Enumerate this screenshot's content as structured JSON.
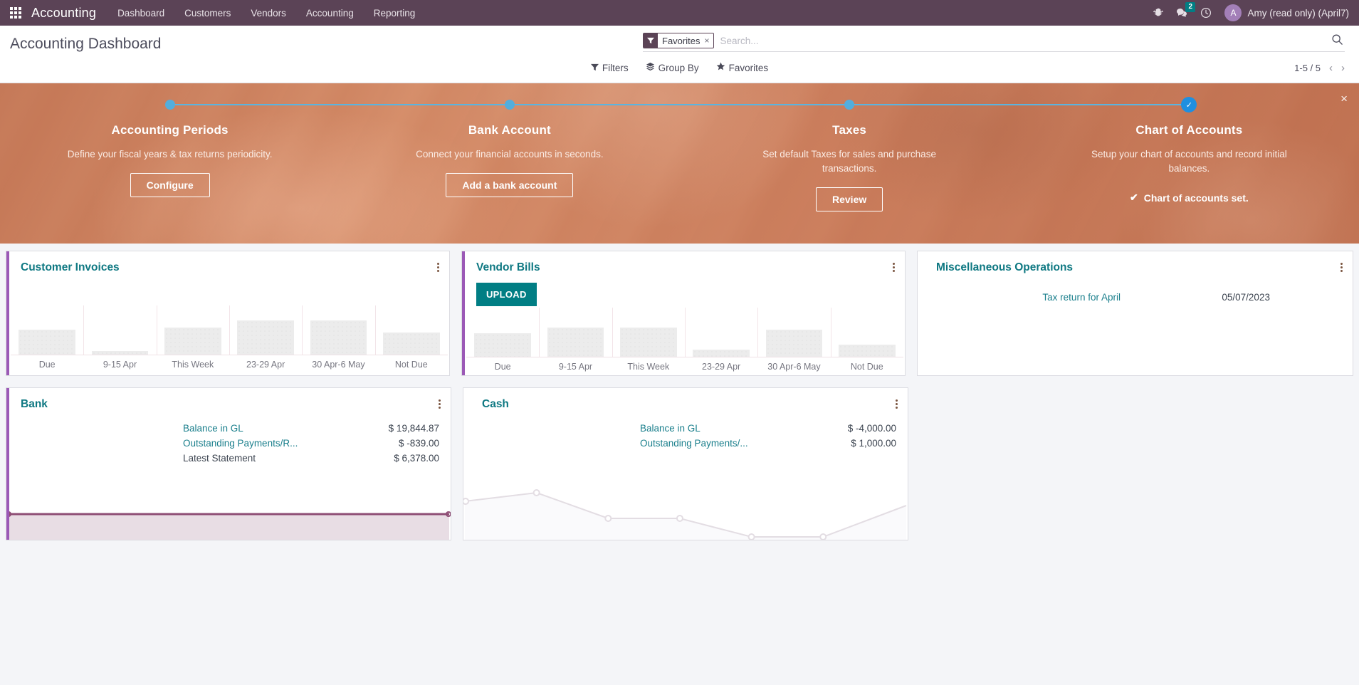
{
  "navbar": {
    "apps_icon": "apps-grid-icon",
    "brand": "Accounting",
    "menus": [
      "Dashboard",
      "Customers",
      "Vendors",
      "Accounting",
      "Reporting"
    ],
    "bug_icon": "bug-icon",
    "messages_icon": "messages-icon",
    "messages_count": "2",
    "activity_icon": "clock-icon",
    "avatar_initial": "A",
    "user": "Amy (read only) (April7)",
    "bg_color": "#5b4356"
  },
  "control_panel": {
    "page_title": "Accounting Dashboard",
    "search": {
      "facet_icon": "filter-icon",
      "facet_label": "Favorites",
      "facet_remove": "×",
      "placeholder": "Search...",
      "value": "",
      "search_icon": "search-icon"
    },
    "menus": [
      {
        "label": "Filters",
        "icon": "filter-icon"
      },
      {
        "label": "Group By",
        "icon": "layers-icon"
      },
      {
        "label": "Favorites",
        "icon": "star-icon"
      }
    ],
    "pager": {
      "range": "1-5 / 5",
      "prev": "‹",
      "next": "›"
    }
  },
  "banner": {
    "close": "×",
    "accent_color": "#52aedd",
    "done_color": "#1f8fe0",
    "steps": [
      {
        "title": "Accounting Periods",
        "desc": "Define your fiscal years & tax returns periodicity.",
        "button": "Configure",
        "state": "todo"
      },
      {
        "title": "Bank Account",
        "desc": "Connect your financial accounts in seconds.",
        "button": "Add a bank account",
        "state": "todo"
      },
      {
        "title": "Taxes",
        "desc": "Set default Taxes for sales and purchase transactions.",
        "button": "Review",
        "state": "todo"
      },
      {
        "title": "Chart of Accounts",
        "desc": "Setup your chart of accounts and record initial balances.",
        "done_text": "Chart of accounts set.",
        "check_icon": "check-icon",
        "state": "done"
      }
    ]
  },
  "cards": {
    "customer_invoices": {
      "title": "Customer Invoices",
      "kebab": "options-icon",
      "accent_color": "#9b59b6"
    },
    "vendor_bills": {
      "title": "Vendor Bills",
      "kebab": "options-icon",
      "upload_label": "UPLOAD",
      "upload_color": "#017e84",
      "accent_color": "#9b59b6"
    },
    "misc_operations": {
      "title": "Miscellaneous Operations",
      "kebab": "options-icon",
      "rows": [
        {
          "name": "Tax return for April",
          "date": "05/07/2023"
        }
      ]
    },
    "bank": {
      "title": "Bank",
      "kebab": "options-icon",
      "accent_color": "#9b59b6",
      "rows": [
        {
          "label": "Balance in GL",
          "value": "$ 19,844.87",
          "link": true
        },
        {
          "label": "Outstanding Payments/R...",
          "value": "$ -839.00",
          "link": true
        },
        {
          "label": "Latest Statement",
          "value": "$ 6,378.00",
          "link": false
        }
      ]
    },
    "cash": {
      "title": "Cash",
      "kebab": "options-icon",
      "rows": [
        {
          "label": "Balance in GL",
          "value": "$ -4,000.00",
          "link": true
        },
        {
          "label": "Outstanding Payments/...",
          "value": "$ 1,000.00",
          "link": true
        }
      ]
    }
  },
  "chart_data": [
    {
      "type": "bar",
      "title": "Customer Invoices",
      "categories": [
        "Due",
        "9-15 Apr",
        "This Week",
        "23-29 Apr",
        "30 Apr-6 May",
        "Not Due"
      ],
      "values": [
        36,
        5,
        39,
        48,
        48,
        31
      ],
      "xlabel": "",
      "ylabel": "",
      "ylim": [
        0,
        72
      ],
      "grid": true,
      "legend": "none"
    },
    {
      "type": "bar",
      "title": "Vendor Bills",
      "categories": [
        "Due",
        "9-15 Apr",
        "This Week",
        "23-29 Apr",
        "30 Apr-6 May",
        "Not Due"
      ],
      "values": [
        33,
        42,
        42,
        10,
        38,
        17
      ],
      "xlabel": "",
      "ylabel": "",
      "ylim": [
        0,
        72
      ],
      "grid": true,
      "legend": "none"
    },
    {
      "type": "area",
      "title": "Bank",
      "x": [
        0,
        1
      ],
      "values": [
        50,
        50
      ],
      "line_color": "#8e4d74",
      "fill_color": "#e8dde4",
      "xlabel": "",
      "ylabel": "",
      "grid": false,
      "legend": "none"
    },
    {
      "type": "area",
      "title": "Cash",
      "x": [
        0,
        1,
        2,
        3,
        4,
        5,
        6
      ],
      "values": [
        62,
        78,
        36,
        36,
        8,
        8,
        55
      ],
      "line_color": "#e2dde2",
      "fill_color": "#fafafc",
      "xlabel": "",
      "ylabel": "",
      "grid": false,
      "legend": "none"
    }
  ]
}
